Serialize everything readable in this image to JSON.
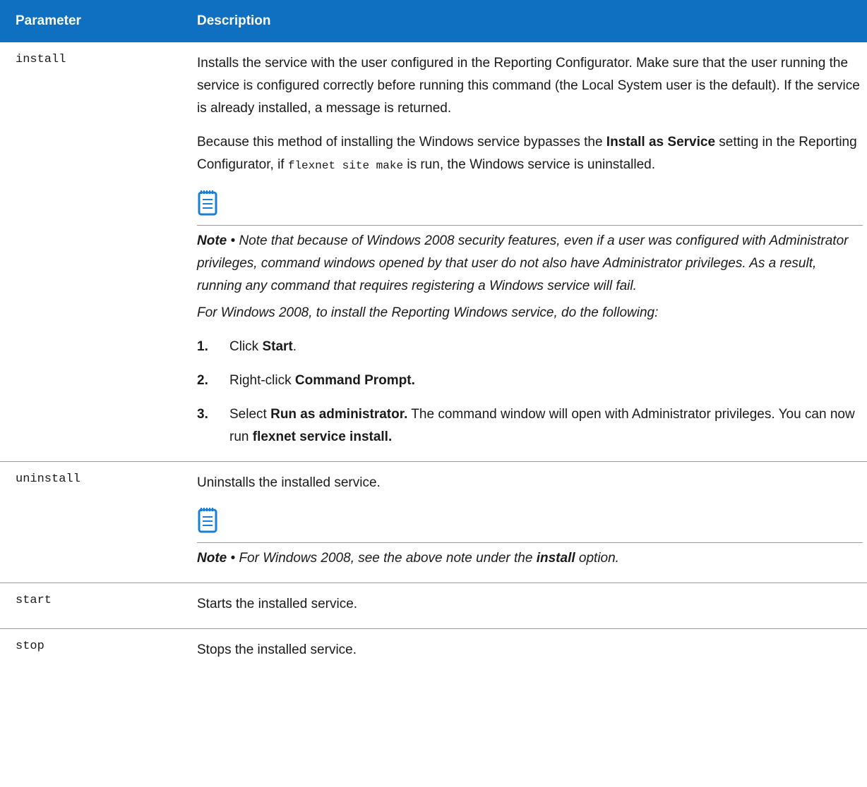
{
  "header": {
    "parameter": "Parameter",
    "description": "Description"
  },
  "install": {
    "param": "install",
    "desc1": "Installs the service with the user configured in the Reporting Configurator. Make sure that the user running the service is configured correctly before running this command (the Local System user is the default). If the service is already installed, a message is returned.",
    "desc2_a": "Because this method of installing the Windows service bypasses the ",
    "desc2_b": "Install as Service",
    "desc2_c": " setting in the Reporting Configurator, if ",
    "desc2_code": "flexnet site make",
    "desc2_d": " is run, the Windows service is uninstalled.",
    "note_label": "Note",
    "note_sep": " • ",
    "note_text": "Note that because of Windows 2008 security features, even if a user was configured with Administrator privileges, command windows opened by that user do not also have Administrator privileges. As a result, running any command that requires registering a Windows service will fail.",
    "note_followup": "For Windows 2008, to install the Reporting Windows service, do the following:",
    "steps": [
      {
        "num": "1.",
        "pre": "Click ",
        "bold": "Start",
        "post": "."
      },
      {
        "num": "2.",
        "pre": "Right-click ",
        "bold": "Command Prompt.",
        "post": ""
      },
      {
        "num": "3.",
        "pre": "Select ",
        "bold": "Run as administrator.",
        "post": " The command window will open with Administrator privileges. You can now run ",
        "bold2": "flexnet service install."
      }
    ]
  },
  "uninstall": {
    "param": "uninstall",
    "desc": "Uninstalls the installed service.",
    "note_label": "Note",
    "note_sep": " • ",
    "note_pre": "For Windows 2008, see the above note under the ",
    "note_bold": "install",
    "note_post": " option."
  },
  "start": {
    "param": "start",
    "desc": "Starts the installed service."
  },
  "stop": {
    "param": "stop",
    "desc": "Stops the installed service."
  },
  "colors": {
    "header_bg": "#0f6fc0",
    "icon": "#1a7fd4",
    "divider": "#9a9a9a"
  },
  "icons": {
    "note": "notepad-icon"
  }
}
